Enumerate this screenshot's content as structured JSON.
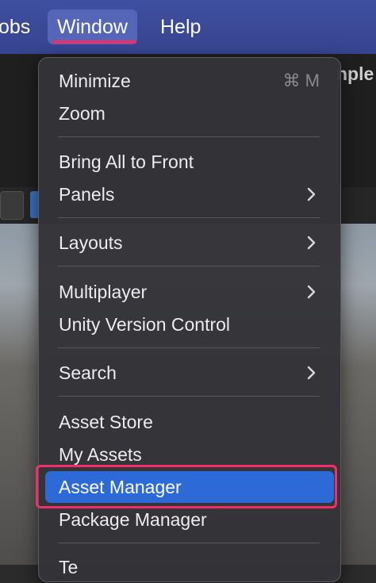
{
  "menubar": {
    "items": [
      {
        "label": "obs"
      },
      {
        "label": "Window"
      },
      {
        "label": "Help"
      }
    ]
  },
  "editor": {
    "title_fragment": "nple"
  },
  "window_menu": {
    "groups": [
      [
        {
          "label": "Minimize",
          "shortcut": "⌘ M"
        },
        {
          "label": "Zoom"
        }
      ],
      [
        {
          "label": "Bring All to Front"
        },
        {
          "label": "Panels",
          "submenu": true
        }
      ],
      [
        {
          "label": "Layouts",
          "submenu": true
        }
      ],
      [
        {
          "label": "Multiplayer",
          "submenu": true
        },
        {
          "label": "Unity Version Control"
        }
      ],
      [
        {
          "label": "Search",
          "submenu": true
        }
      ],
      [
        {
          "label": "Asset Store"
        },
        {
          "label": "My Assets"
        },
        {
          "label": "Asset Manager",
          "selected": true
        },
        {
          "label": "Package Manager"
        }
      ]
    ],
    "partial_last_item": "Te"
  },
  "colors": {
    "menubar": "#3f4fa0",
    "selection": "#2d6ad8",
    "annotation": "#ee2f6a"
  }
}
